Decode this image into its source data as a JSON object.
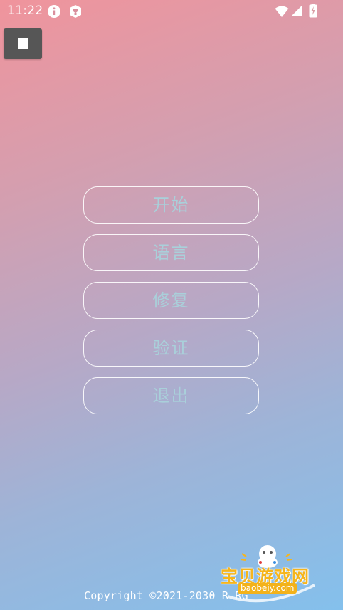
{
  "status_bar": {
    "time": "11:22",
    "icons": [
      "info-icon",
      "app-notification-icon",
      "wifi-icon",
      "signal-icon",
      "battery-charging-icon"
    ]
  },
  "controls": {
    "stop_icon": "stop-square-icon"
  },
  "menu": {
    "items": [
      {
        "label": "开始"
      },
      {
        "label": "语言"
      },
      {
        "label": "修复"
      },
      {
        "label": "验证"
      },
      {
        "label": "退出"
      }
    ]
  },
  "footer": {
    "copyright": "Copyright ©2021-2030 R RG"
  },
  "watermark": {
    "title": "宝贝游戏网",
    "url": "baobeiy.com"
  },
  "colors": {
    "gradient_top": "#f0949c",
    "gradient_bottom": "#84c0ec",
    "button_text": "#a9d0da",
    "button_border": "#ffffff",
    "stop_button_bg": "#565656",
    "watermark_accent": "#f6b51c"
  }
}
